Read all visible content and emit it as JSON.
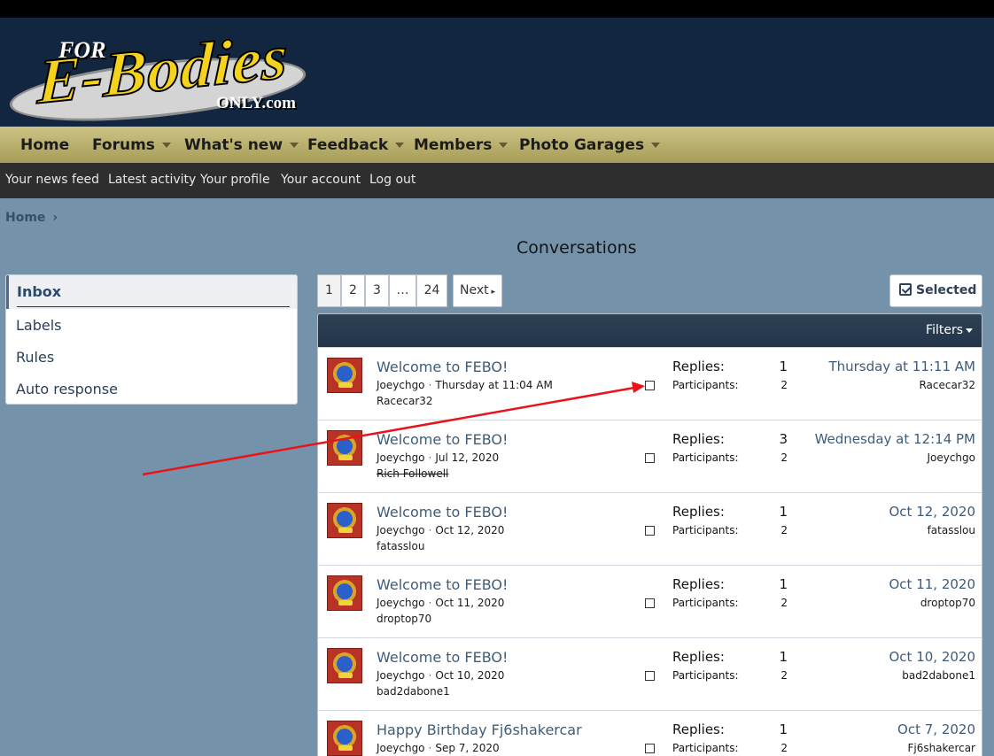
{
  "logo": {
    "line1": "FOR",
    "line2": "E-Bodies",
    "line3": "ONLY.com"
  },
  "nav": [
    {
      "label": "Home",
      "caret": false
    },
    {
      "label": "Forums",
      "caret": true
    },
    {
      "label": "What's new",
      "caret": true
    },
    {
      "label": "Feedback",
      "caret": true
    },
    {
      "label": "Members",
      "caret": true
    },
    {
      "label": "Photo Garages",
      "caret": true
    }
  ],
  "subnav": [
    "Your news feed",
    "Latest activity",
    "Your profile",
    "Your account",
    "Log out"
  ],
  "breadcrumb": {
    "home": "Home",
    "sep": "›"
  },
  "page_title": "Conversations",
  "sidebar": {
    "items": [
      "Inbox",
      "Labels",
      "Rules",
      "Auto response"
    ],
    "selected": "Inbox"
  },
  "pagination": {
    "pages": [
      "1",
      "2",
      "3",
      "…",
      "24"
    ],
    "current": "1",
    "next": "Next"
  },
  "selected_button": "Selected",
  "filters": "Filters",
  "labels": {
    "replies": "Replies:",
    "participants": "Participants:"
  },
  "conversations": [
    {
      "title": "Welcome to FEBO!",
      "author": "Joeychgo",
      "started": "Thursday at 11:04 AM",
      "recipient": "Racecar32",
      "recipient_strike": false,
      "replies": "1",
      "participants": "2",
      "last_date": "Thursday at 11:11 AM",
      "last_user": "Racecar32"
    },
    {
      "title": "Welcome to FEBO!",
      "author": "Joeychgo",
      "started": "Jul 12, 2020",
      "recipient": "Rich Followell",
      "recipient_strike": true,
      "replies": "3",
      "participants": "2",
      "last_date": "Wednesday at 12:14 PM",
      "last_user": "Joeychgo"
    },
    {
      "title": "Welcome to FEBO!",
      "author": "Joeychgo",
      "started": "Oct 12, 2020",
      "recipient": "fatasslou",
      "recipient_strike": false,
      "replies": "1",
      "participants": "2",
      "last_date": "Oct 12, 2020",
      "last_user": "fatasslou"
    },
    {
      "title": "Welcome to FEBO!",
      "author": "Joeychgo",
      "started": "Oct 11, 2020",
      "recipient": "droptop70",
      "recipient_strike": false,
      "replies": "1",
      "participants": "2",
      "last_date": "Oct 11, 2020",
      "last_user": "droptop70"
    },
    {
      "title": "Welcome to FEBO!",
      "author": "Joeychgo",
      "started": "Oct 10, 2020",
      "recipient": "bad2dabone1",
      "recipient_strike": false,
      "replies": "1",
      "participants": "2",
      "last_date": "Oct 10, 2020",
      "last_user": "bad2dabone1"
    },
    {
      "title": "Happy Birthday Fj6shakercar",
      "author": "Joeychgo",
      "started": "Sep 7, 2020",
      "recipient": "",
      "recipient_strike": false,
      "replies": "1",
      "participants": "2",
      "last_date": "Oct 7, 2020",
      "last_user": "Fj6shakercar"
    }
  ],
  "colors": {
    "header": "#12273f",
    "nav": "#c2b873",
    "subnav": "#2e2e2e",
    "page_bg": "#7592ab",
    "link": "#3e5c7a",
    "annotation_arrow": "#e8141a"
  }
}
